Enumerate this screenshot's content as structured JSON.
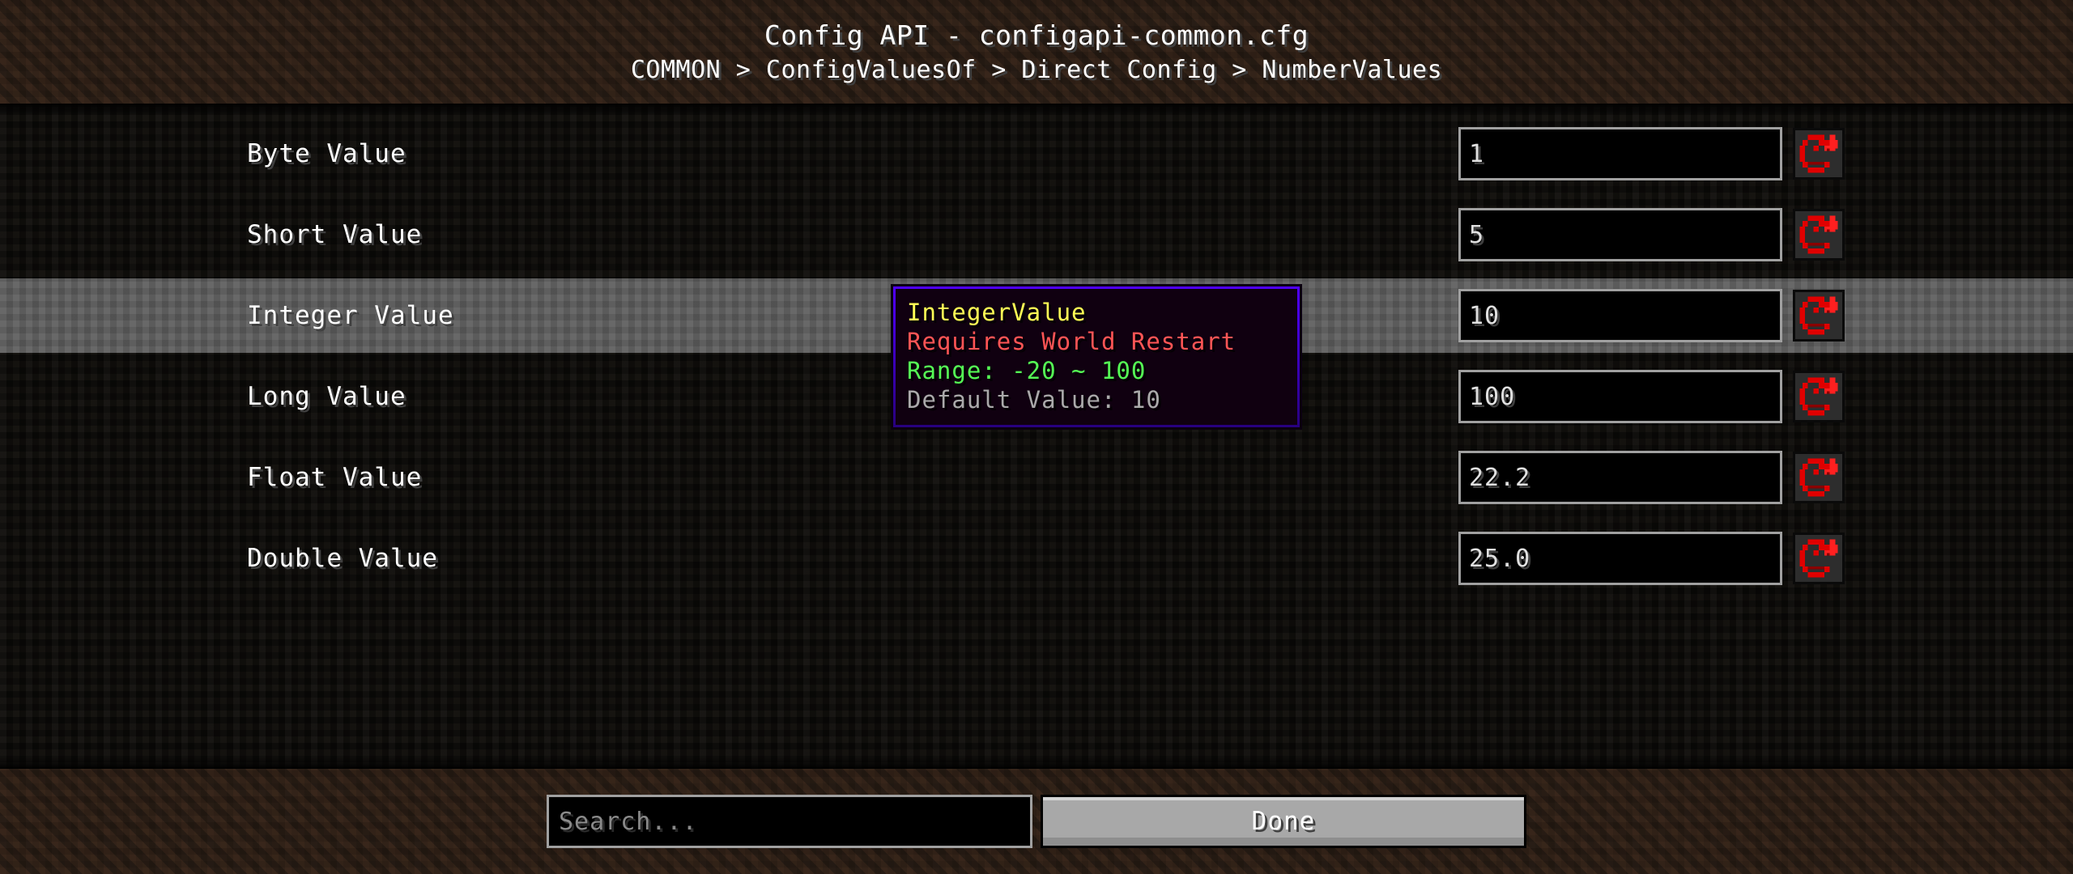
{
  "header": {
    "title": "Config API - configapi-common.cfg",
    "breadcrumb": "COMMON > ConfigValuesOf > Direct Config > NumberValues"
  },
  "rows": [
    {
      "label": "Byte Value",
      "value": "1",
      "selected": false,
      "reset_icon": "reset-arrow-icon"
    },
    {
      "label": "Short Value",
      "value": "5",
      "selected": false,
      "reset_icon": "reset-arrow-icon"
    },
    {
      "label": "Integer Value",
      "value": "10",
      "selected": true,
      "reset_icon": "reset-arrow-icon"
    },
    {
      "label": "Long Value",
      "value": "100",
      "selected": false,
      "reset_icon": "reset-arrow-icon"
    },
    {
      "label": "Float Value",
      "value": "22.2",
      "selected": false,
      "reset_icon": "reset-arrow-icon"
    },
    {
      "label": "Double Value",
      "value": "25.0",
      "selected": false,
      "reset_icon": "reset-arrow-icon"
    }
  ],
  "tooltip": {
    "name": "IntegerValue",
    "restart": "Requires World Restart",
    "range": "Range: -20 ~ 100",
    "default": "Default Value: 10"
  },
  "footer": {
    "search_value": "",
    "search_placeholder": "Search...",
    "done_label": "Done"
  },
  "colors": {
    "tooltip_name": "#ffff55",
    "tooltip_restart": "#ff5555",
    "tooltip_range": "#55ff55",
    "tooltip_default": "#aaaaaa",
    "reset_icon": "#e00000",
    "selected_row": "#5a5a5a",
    "input_border": "#a0a0a0"
  }
}
